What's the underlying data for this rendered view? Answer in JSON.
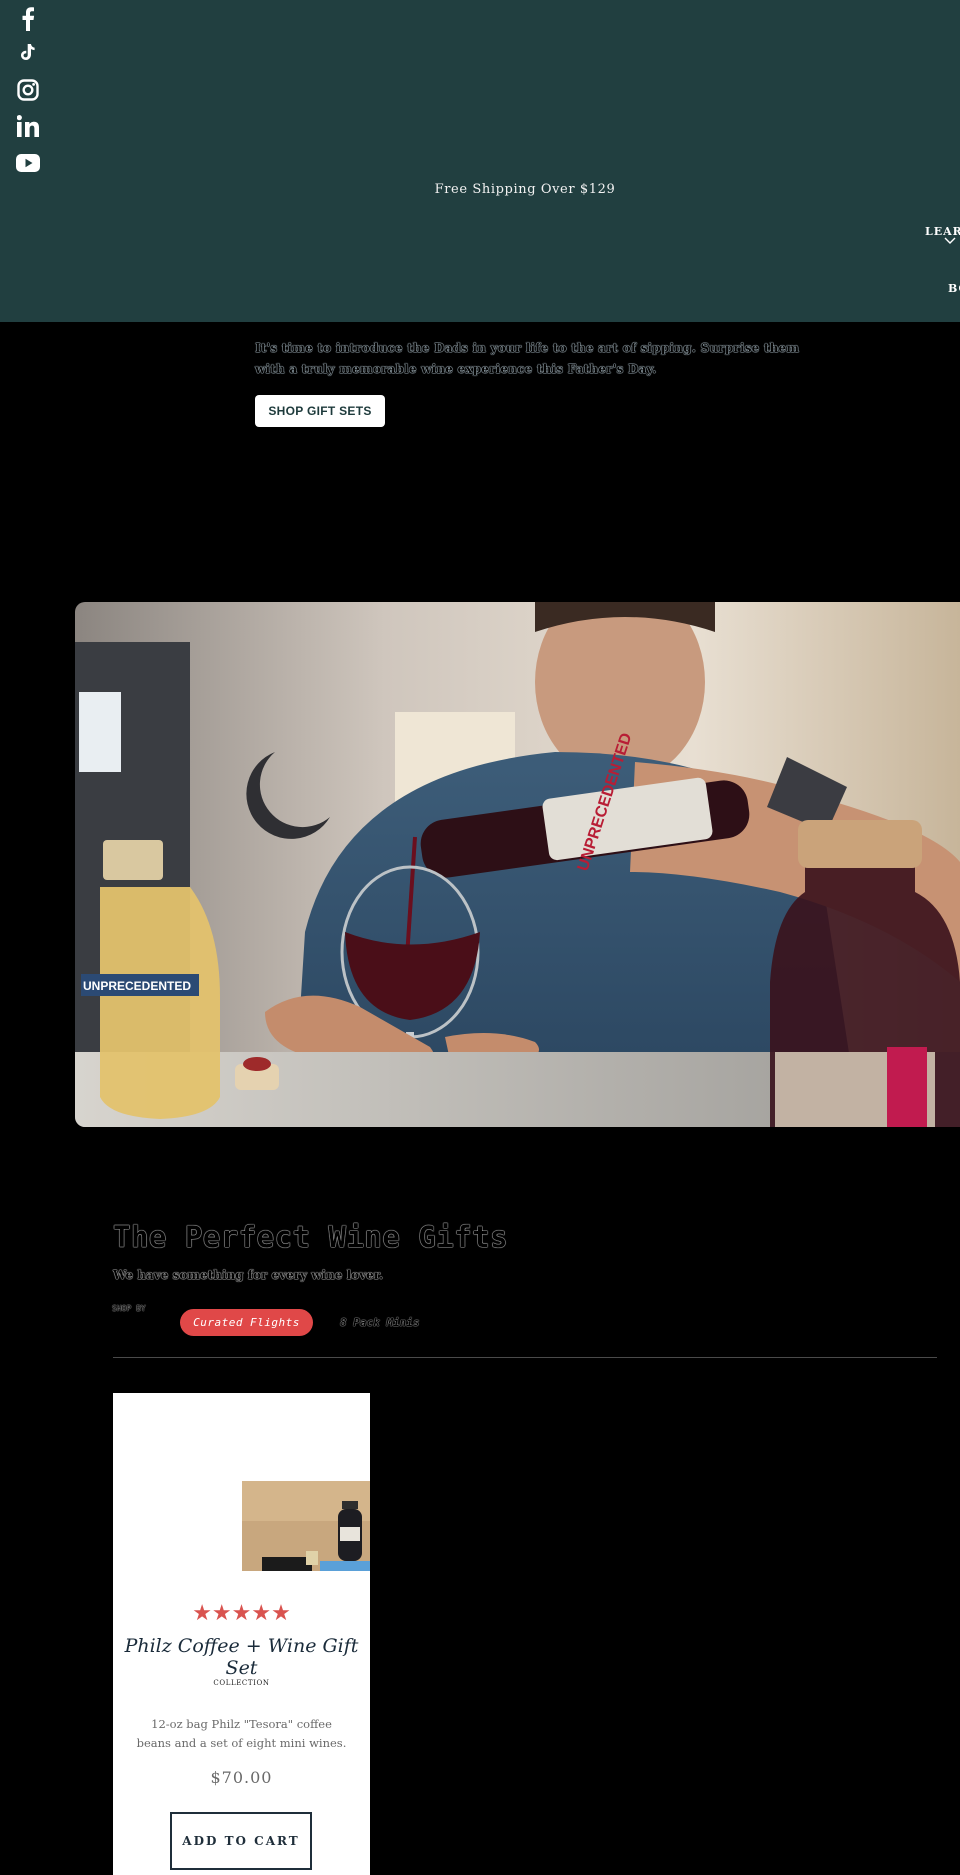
{
  "social": [
    {
      "name": "facebook",
      "icon": "facebook-icon"
    },
    {
      "name": "tiktok",
      "icon": "tiktok-icon"
    },
    {
      "name": "instagram",
      "icon": "instagram-icon"
    },
    {
      "name": "linkedin",
      "icon": "linkedin-icon"
    },
    {
      "name": "youtube",
      "icon": "youtube-icon"
    }
  ],
  "announcement": "Free Shipping Over $129",
  "nav": {
    "learn_label": "LEARN",
    "bo_label": "BO"
  },
  "hero": {
    "text": "It's time to introduce the Dads in your life to the art of sipping. Surprise them with a truly memorable wine experience this Father's Day.",
    "cta_label": "SHOP GIFT SETS"
  },
  "photo": {
    "bottle_label": "UNPRECEDENTED",
    "icon": "man-pouring-wine-photo"
  },
  "gifts": {
    "title": "The Perfect Wine Gifts",
    "subtitle": "We have something for every wine lover.",
    "filter_label": "SHOP BY",
    "filters": [
      {
        "label": "Curated Flights",
        "active": true
      },
      {
        "label": "8 Pack Minis",
        "active": false
      }
    ]
  },
  "product": {
    "rating": 5,
    "stars": "★★★★★",
    "title": "Philz Coffee + Wine Gift Set",
    "collection": "COLLECTION",
    "description": "12-oz bag Philz \"Tesora\" coffee beans and a set of eight mini wines.",
    "price": "$70.00",
    "add_to_cart_label": "ADD TO CART"
  },
  "colors": {
    "topbar": "#213f40",
    "accent": "#e04848",
    "star": "#d9534f",
    "page_bg": "#000000"
  }
}
